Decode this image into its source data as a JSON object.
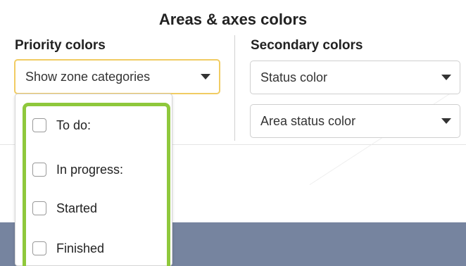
{
  "panel": {
    "title": "Areas & axes colors"
  },
  "priority": {
    "label": "Priority colors",
    "dropdown_value": "Show zone categories",
    "options": [
      {
        "label": "To do:",
        "checked": false
      },
      {
        "label": "In progress:",
        "checked": false
      },
      {
        "label": "Started",
        "checked": false
      },
      {
        "label": "Finished",
        "checked": false
      }
    ]
  },
  "secondary": {
    "label": "Secondary colors",
    "dropdown_1_value": "Status color",
    "dropdown_2_value": "Area status color"
  },
  "colors": {
    "highlight_border": "#8fc83c",
    "active_dropdown_border": "#f1cc63",
    "bottom_band": "#76849f"
  }
}
